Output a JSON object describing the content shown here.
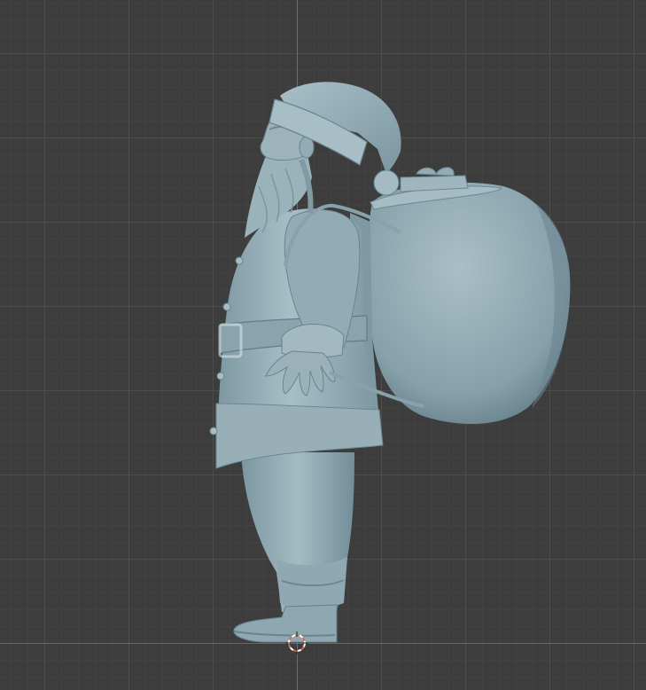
{
  "viewport": {
    "background_color": "#3d3d3d",
    "grid_minor_color": "#474747",
    "grid_major_color": "#4e4e4e",
    "axis_z_color": "#4f6fb5",
    "axis_y_color": "#b04848",
    "model_base_color": "#8fa7b0",
    "model_shadow_color": "#6b8590",
    "model_highlight_color": "#b2c8cf"
  },
  "model": {
    "icon": "santa-claus-sculpt-icon"
  },
  "cursor": {
    "icon": "3d-cursor-icon",
    "colors": [
      "#e06a3a",
      "#ffffff"
    ]
  }
}
